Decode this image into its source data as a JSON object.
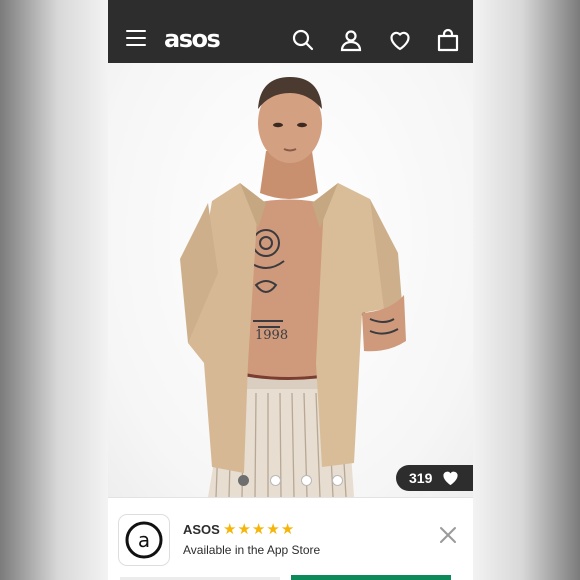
{
  "header": {
    "logo": "asos",
    "icons": [
      "menu-icon",
      "search-icon",
      "account-icon",
      "heart-icon",
      "bag-icon"
    ]
  },
  "gallery": {
    "slide_count": 4,
    "active_slide": 1,
    "saves_count": "319"
  },
  "app_banner": {
    "app_name": "ASOS",
    "rating_stars": 5,
    "subtitle": "Available in the App Store",
    "icon_letter": "a"
  },
  "colors": {
    "header_bg": "#2d2d2d",
    "star": "#f5b50b",
    "accent_green": "#0d8a5a"
  }
}
